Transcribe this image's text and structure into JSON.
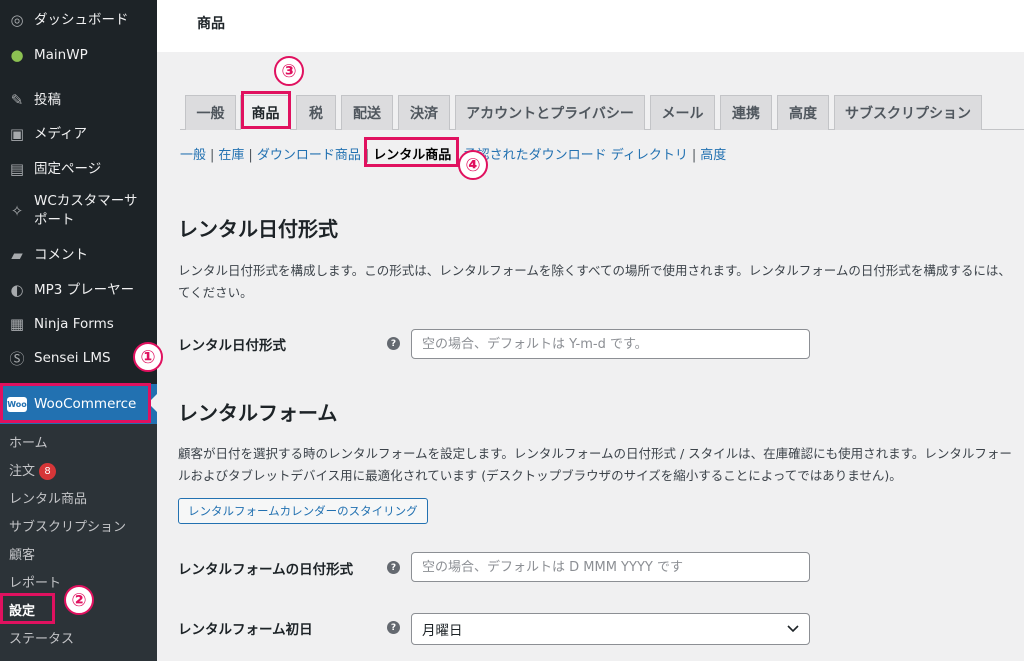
{
  "sidebar": {
    "items": [
      {
        "label": "ダッシュボード",
        "icon": "dashboard-icon"
      },
      {
        "label": "MainWP",
        "icon": "mainwp-icon"
      },
      {
        "label": "投稿",
        "icon": "pin-icon"
      },
      {
        "label": "メディア",
        "icon": "media-icon"
      },
      {
        "label": "固定ページ",
        "icon": "page-icon"
      },
      {
        "label": "WCカスタマーサ",
        "label2": "ポート",
        "icon": "support-icon"
      },
      {
        "label": "コメント",
        "icon": "comment-icon"
      },
      {
        "label": "MP3 プレーヤー",
        "icon": "audio-icon"
      },
      {
        "label": "Ninja Forms",
        "icon": "forms-icon"
      },
      {
        "label": "Sensei LMS",
        "icon": "sensei-icon"
      },
      {
        "label": "WooCommerce",
        "icon": "woocommerce-icon",
        "logo_text": "Woo"
      }
    ],
    "submenu": [
      {
        "label": "ホーム"
      },
      {
        "label": "注文",
        "badge": "8"
      },
      {
        "label": "レンタル商品"
      },
      {
        "label": "サブスクリプション"
      },
      {
        "label": "顧客"
      },
      {
        "label": "レポート"
      },
      {
        "label": "設定"
      },
      {
        "label": "ステータス"
      }
    ]
  },
  "header": {
    "title": "商品"
  },
  "tabs": [
    "一般",
    "商品",
    "税",
    "配送",
    "決済",
    "アカウントとプライバシー",
    "メール",
    "連携",
    "高度",
    "サブスクリプション"
  ],
  "subnav": {
    "items": [
      "一般",
      "在庫",
      "ダウンロード商品",
      "レンタル商品",
      "承認されたダウンロード ディレクトリ",
      "高度"
    ]
  },
  "annotations": [
    "①",
    "②",
    "③",
    "④"
  ],
  "sections": {
    "date_format": {
      "heading": "レンタル日付形式",
      "description": "レンタル日付形式を構成します。この形式は、レンタルフォームを除くすべての場所で使用されます。レンタルフォームの日付形式を構成するには、",
      "description2": "てください。",
      "field_label": "レンタル日付形式",
      "placeholder": "空の場合、デフォルトは Y-m-d です。"
    },
    "rental_form": {
      "heading": "レンタルフォーム",
      "description": "顧客が日付を選択する時のレンタルフォームを設定します。レンタルフォームの日付形式 / スタイルは、在庫確認にも使用されます。レンタルフォー",
      "description2": "ルおよびタブレットデバイス用に最適化されています (デスクトップブラウザのサイズを縮小することによってではありません)。",
      "button_label": "レンタルフォームカレンダーのスタイリング",
      "format_label": "レンタルフォームの日付形式",
      "format_placeholder": "空の場合、デフォルトは D MMM YYYY です",
      "first_day_label": "レンタルフォーム初日",
      "first_day_value": "月曜日"
    }
  },
  "help_glyph": "?",
  "colors": {
    "sidebar": "#1d2327",
    "accent": "#2271b1",
    "annotation": "#e0115f",
    "badge": "#d63638"
  }
}
